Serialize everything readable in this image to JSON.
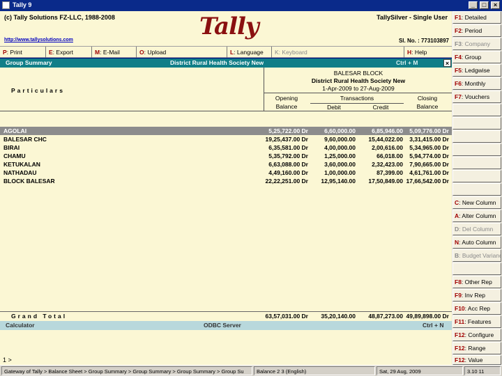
{
  "window": {
    "title": "Tally 9"
  },
  "header": {
    "copyright": "(c) Tally Solutions FZ-LLC, 1988-2008",
    "edition": "TallySilver - Single User",
    "logo": "Tally",
    "url": "http://www.tallysolutions.com",
    "serial": "Sl. No. : 773103897"
  },
  "topmenu": [
    {
      "key": "P",
      "rest": ": Print"
    },
    {
      "key": "E",
      "rest": ": Export"
    },
    {
      "key": "M",
      "rest": ": E-Mail"
    },
    {
      "key": "O",
      "rest": ": Upload"
    },
    {
      "key": "L",
      "rest": ": Language"
    },
    {
      "key": "K",
      "rest": ": Keyboard"
    },
    {
      "key": "H",
      "rest": ": Help"
    }
  ],
  "report": {
    "type": "Group Summary",
    "company": "District Rural Health Society New",
    "shortcut": "Ctrl + M",
    "particulars_label": "Particulars",
    "title_block": "BALESAR BLOCK",
    "title_company": "District Rural Health Society New",
    "period": "1-Apr-2009 to 27-Aug-2009",
    "col_opening": "Opening",
    "col_transactions": "Transactions",
    "col_closing": "Closing",
    "col_balance": "Balance",
    "col_debit": "Debit",
    "col_credit": "Credit",
    "rows": [
      {
        "name": "AGOLAI",
        "opening": "5,25,722.00 Dr",
        "debit": "6,60,000.00",
        "credit": "6,85,946.00",
        "closing": "5,09,776.00 Dr"
      },
      {
        "name": "BALESAR CHC",
        "opening": "19,25,437.00 Dr",
        "debit": "9,60,000.00",
        "credit": "15,44,022.00",
        "closing": "3,31,415.00 Dr"
      },
      {
        "name": "BIRAI",
        "opening": "6,35,581.00 Dr",
        "debit": "4,00,000.00",
        "credit": "2,00,616.00",
        "closing": "5,34,965.00 Dr"
      },
      {
        "name": "CHAMU",
        "opening": "5,35,792.00 Dr",
        "debit": "1,25,000.00",
        "credit": "66,018.00",
        "closing": "5,94,774.00 Dr"
      },
      {
        "name": "KETUKALAN",
        "opening": "6,63,088.00 Dr",
        "debit": "3,60,000.00",
        "credit": "2,32,423.00",
        "closing": "7,90,665.00 Dr"
      },
      {
        "name": "NATHADAU",
        "opening": "4,49,160.00 Dr",
        "debit": "1,00,000.00",
        "credit": "87,399.00",
        "closing": "4,61,761.00 Dr"
      },
      {
        "name": "BLOCK BALESAR",
        "opening": "22,22,251.00 Dr",
        "debit": "12,95,140.00",
        "credit": "17,50,849.00",
        "closing": "17,66,542.00 Dr"
      }
    ],
    "grand_total": {
      "label": "Grand Total",
      "opening": "63,57,031.00 Dr",
      "debit": "35,20,140.00",
      "credit": "48,87,273.00",
      "closing": "49,89,898.00 Dr"
    }
  },
  "calculator": {
    "label": "Calculator",
    "odbc": "ODBC Server",
    "shortcut": "Ctrl + N",
    "prompt": "1 >"
  },
  "statusbar": {
    "path": "Gateway of Tally > Balance Sheet > Group Summary > Group Summary > Group Summary > Group Su",
    "lang": "Balance 2  3 (English)",
    "date": "Sat, 29 Aug, 2009",
    "version": "3.10 11"
  },
  "rpanel": [
    {
      "key": "F1",
      "rest": ": Detailed",
      "enabled": true
    },
    {
      "key": "F2",
      "rest": ": Period",
      "enabled": true
    },
    {
      "key": "F3",
      "rest": ": Company",
      "enabled": false
    },
    {
      "key": "F4",
      "rest": ": Group",
      "enabled": true
    },
    {
      "key": "F5",
      "rest": ": Ledgwise",
      "enabled": true
    },
    {
      "key": "F6",
      "rest": ": Monthly",
      "enabled": true
    },
    {
      "key": "F7",
      "rest": ": Vouchers",
      "enabled": true
    },
    {
      "key": "C",
      "rest": ": New Column",
      "enabled": true
    },
    {
      "key": "A",
      "rest": ": Alter Column",
      "enabled": true
    },
    {
      "key": "D",
      "rest": ": Del Column",
      "enabled": false
    },
    {
      "key": "N",
      "rest": ": Auto Column",
      "enabled": true
    },
    {
      "key": "B",
      "rest": ": Budget Variance",
      "enabled": false
    },
    {
      "key": "F8",
      "rest": ": Other Rep",
      "enabled": true
    },
    {
      "key": "F9",
      "rest": ": Inv Rep",
      "enabled": true
    },
    {
      "key": "F10",
      "rest": ": Acc Rep",
      "enabled": true
    },
    {
      "key": "F11",
      "rest": ": Features",
      "enabled": true
    },
    {
      "key": "F12",
      "rest": ": Configure",
      "enabled": true
    },
    {
      "key": "F12",
      "rest": ": Range",
      "enabled": true
    },
    {
      "key": "F12",
      "rest": ": Value",
      "enabled": true
    }
  ]
}
